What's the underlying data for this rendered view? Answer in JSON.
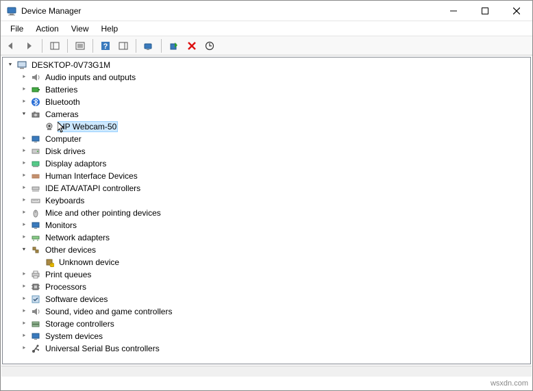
{
  "window": {
    "title": "Device Manager"
  },
  "menu": {
    "file": "File",
    "action": "Action",
    "view": "View",
    "help": "Help"
  },
  "tree": {
    "root": "DESKTOP-0V73G1M",
    "audio": "Audio inputs and outputs",
    "batteries": "Batteries",
    "bluetooth": "Bluetooth",
    "cameras": "Cameras",
    "hp_webcam": "HP Webcam-50",
    "computer": "Computer",
    "disk": "Disk drives",
    "display": "Display adaptors",
    "hid": "Human Interface Devices",
    "ide": "IDE ATA/ATAPI controllers",
    "keyboards": "Keyboards",
    "mice": "Mice and other pointing devices",
    "monitors": "Monitors",
    "network": "Network adapters",
    "other": "Other devices",
    "unknown": "Unknown device",
    "printq": "Print queues",
    "processors": "Processors",
    "software": "Software devices",
    "sound": "Sound, video and game controllers",
    "storage": "Storage controllers",
    "system": "System devices",
    "usb": "Universal Serial Bus controllers"
  },
  "watermark": "wsxdn.com"
}
